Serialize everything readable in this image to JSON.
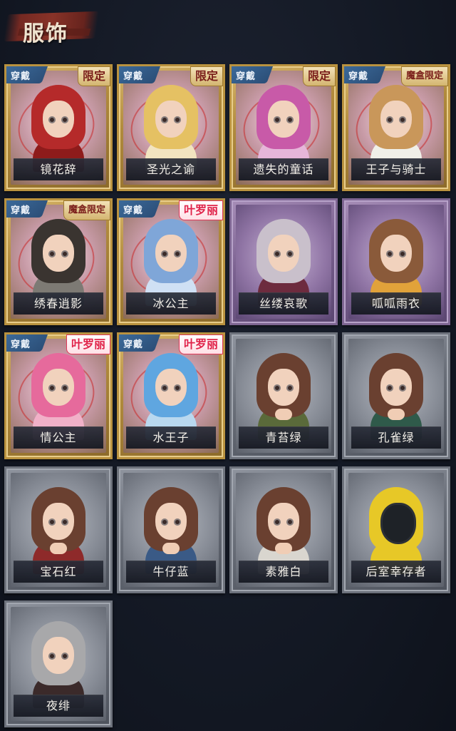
{
  "header": {
    "title": "服饰"
  },
  "common": {
    "wear_label": "穿戴"
  },
  "cards": [
    {
      "name": "镜花辞",
      "frame": "gold",
      "wear": true,
      "tag": "限定",
      "tag_style": "gold",
      "hair": "#b52a2a",
      "outfit": "#8e1b1b"
    },
    {
      "name": "圣光之谕",
      "frame": "gold",
      "wear": true,
      "tag": "限定",
      "tag_style": "gold",
      "hair": "#e5c163",
      "outfit": "#f2e4c0"
    },
    {
      "name": "遗失的童话",
      "frame": "gold",
      "wear": true,
      "tag": "限定",
      "tag_style": "gold",
      "hair": "#c85aa8",
      "outfit": "#e6b6d9"
    },
    {
      "name": "王子与骑士",
      "frame": "gold",
      "wear": true,
      "tag": "魔盒限定",
      "tag_style": "gold-small",
      "hair": "#c9975a",
      "outfit": "#f0efe8"
    },
    {
      "name": "绣春逍影",
      "frame": "gold",
      "wear": true,
      "tag": "魔盒限定",
      "tag_style": "gold-small",
      "hair": "#3a3430",
      "outfit": "#7d7a74"
    },
    {
      "name": "冰公主",
      "frame": "gold",
      "wear": true,
      "tag": "叶罗丽",
      "tag_style": "pink",
      "hair": "#7fa6d8",
      "outfit": "#cfe0f4"
    },
    {
      "name": "丝缕哀歌",
      "frame": "purple",
      "wear": false,
      "tag": "",
      "tag_style": "",
      "hair": "#c9c0cb",
      "outfit": "#6d2b3e"
    },
    {
      "name": "呱呱雨衣",
      "frame": "purple",
      "wear": false,
      "tag": "",
      "tag_style": "",
      "hair": "#8a5a3a",
      "outfit": "#e1a23a"
    },
    {
      "name": "情公主",
      "frame": "gold",
      "wear": true,
      "tag": "叶罗丽",
      "tag_style": "pink",
      "hair": "#e66a9c",
      "outfit": "#f1b1c8"
    },
    {
      "name": "水王子",
      "frame": "gold",
      "wear": true,
      "tag": "叶罗丽",
      "tag_style": "pink",
      "hair": "#5fa6e0",
      "outfit": "#b9d8ef"
    },
    {
      "name": "青苔绿",
      "frame": "gray",
      "wear": false,
      "tag": "",
      "tag_style": "",
      "hair": "#6a4030",
      "outfit": "#5a6a3a"
    },
    {
      "name": "孔雀绿",
      "frame": "gray",
      "wear": false,
      "tag": "",
      "tag_style": "",
      "hair": "#6a4030",
      "outfit": "#2f5a4a"
    },
    {
      "name": "宝石红",
      "frame": "gray",
      "wear": false,
      "tag": "",
      "tag_style": "",
      "hair": "#6a4030",
      "outfit": "#8e2a2a"
    },
    {
      "name": "牛仔蓝",
      "frame": "gray",
      "wear": false,
      "tag": "",
      "tag_style": "",
      "hair": "#6a4030",
      "outfit": "#3a5a86"
    },
    {
      "name": "素雅白",
      "frame": "gray",
      "wear": false,
      "tag": "",
      "tag_style": "",
      "hair": "#6a4030",
      "outfit": "#d9d6cf"
    },
    {
      "name": "后室幸存者",
      "frame": "gray",
      "wear": false,
      "tag": "",
      "tag_style": "",
      "hair": "#e7c827",
      "outfit": "#e7c827"
    },
    {
      "name": "夜绯",
      "frame": "gray",
      "wear": false,
      "tag": "",
      "tag_style": "",
      "hair": "#a8a8aa",
      "outfit": "#3b2a2a"
    }
  ]
}
